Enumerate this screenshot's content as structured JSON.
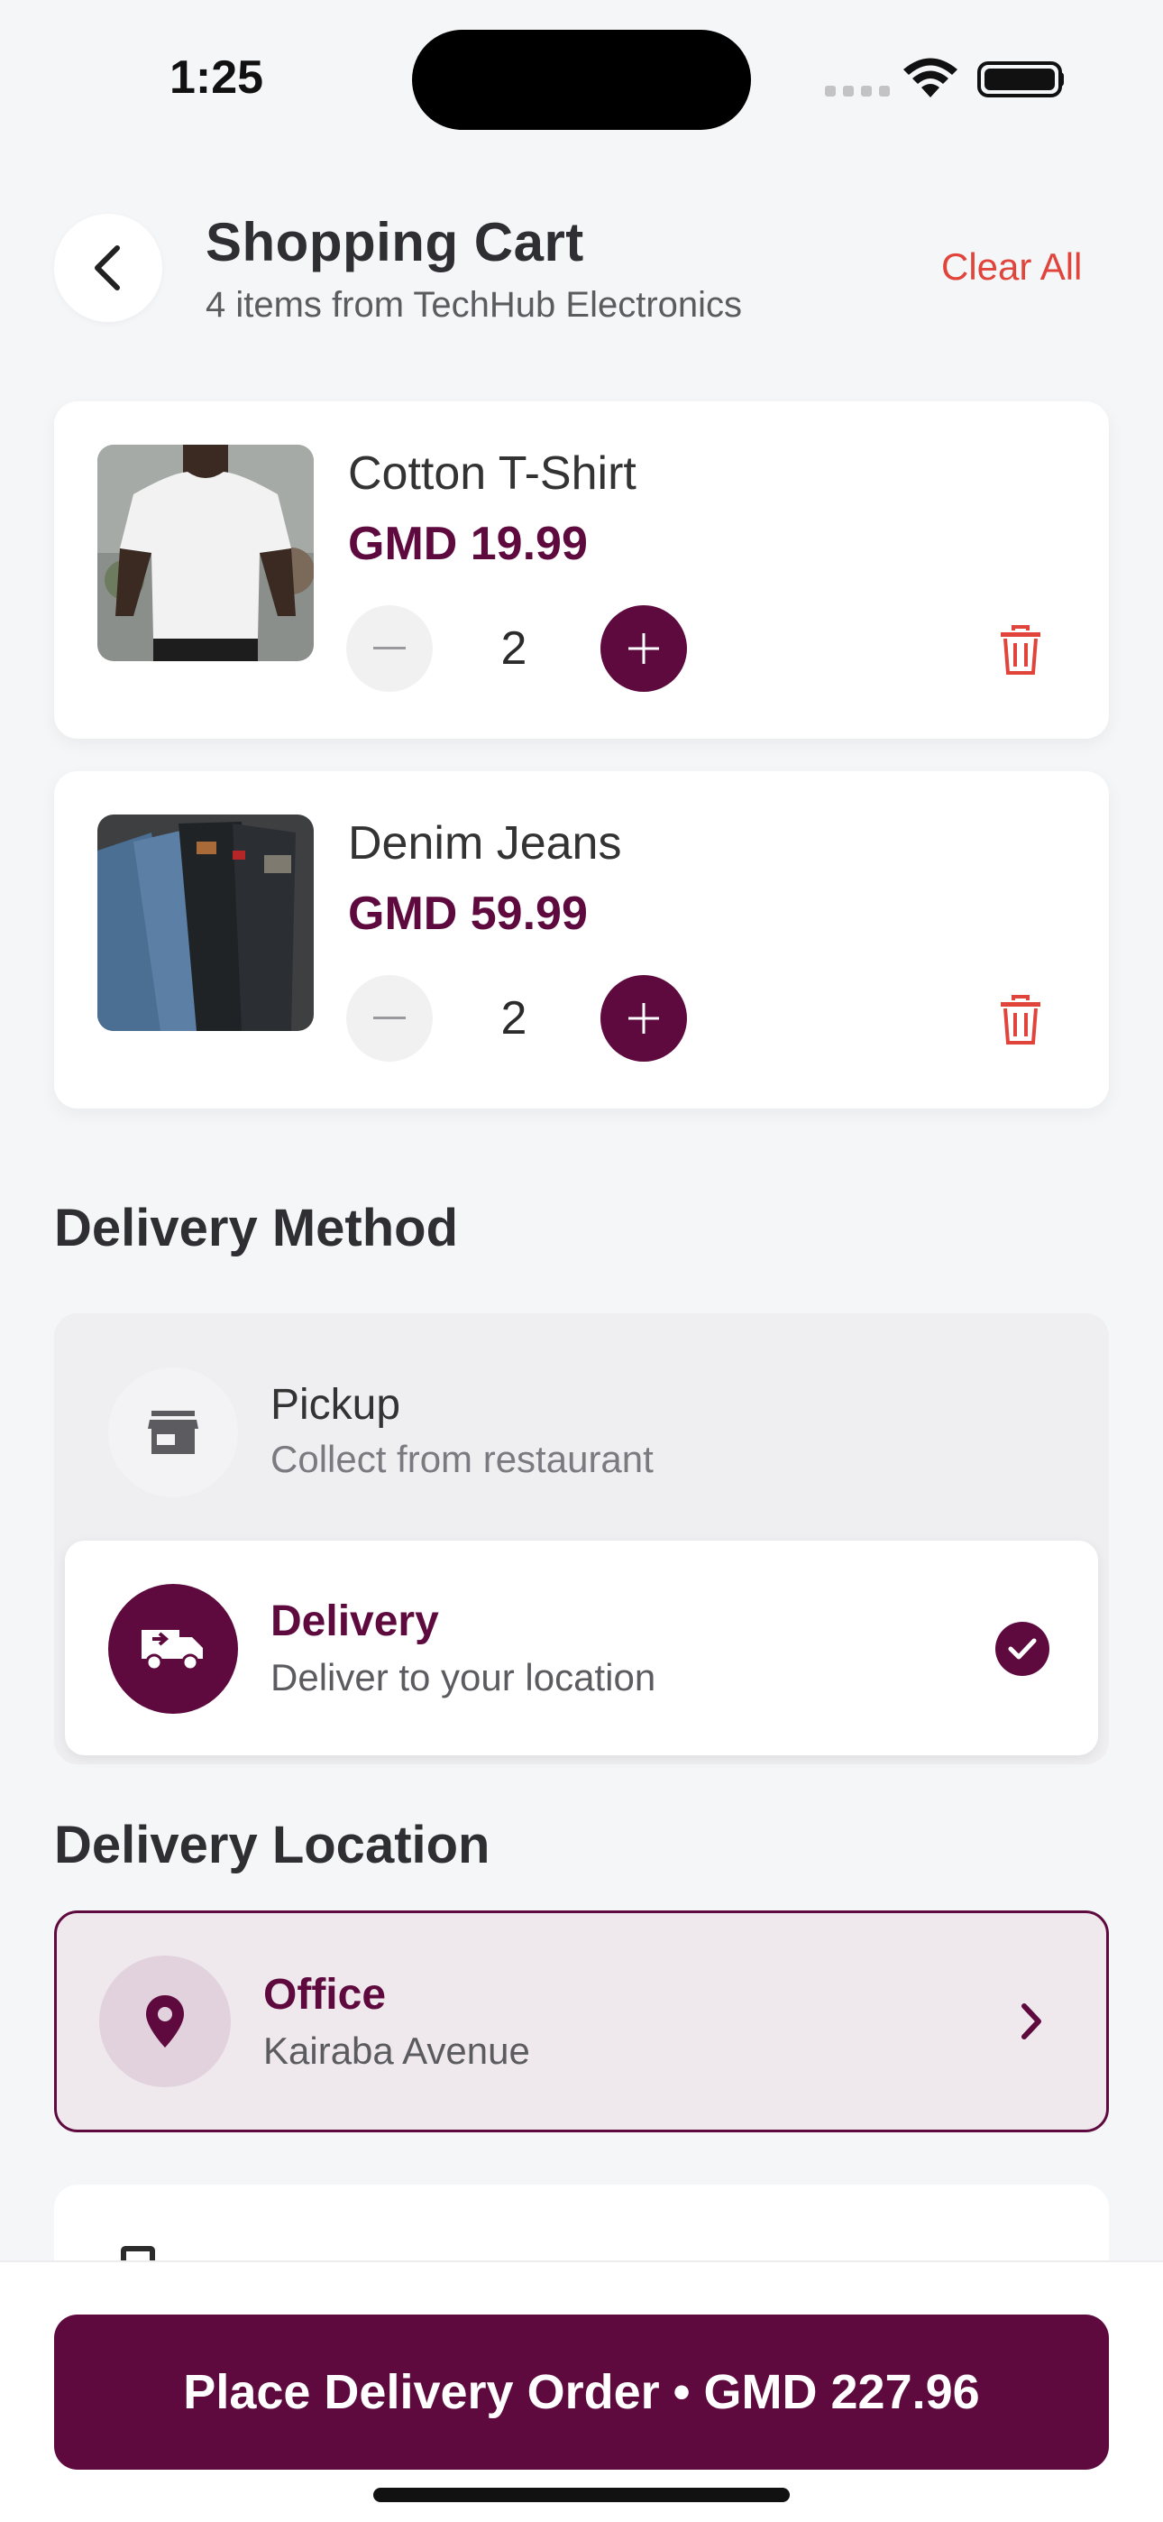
{
  "status_bar": {
    "time": "1:25"
  },
  "header": {
    "title": "Shopping Cart",
    "subtitle": "4 items from TechHub Electronics",
    "clear_all": "Clear All",
    "back_icon": "chevron-left-icon"
  },
  "cart": {
    "items": [
      {
        "name": "Cotton T-Shirt",
        "price": "GMD 19.99",
        "quantity": "2"
      },
      {
        "name": "Denim Jeans",
        "price": "GMD 59.99",
        "quantity": "2"
      }
    ]
  },
  "delivery_method": {
    "title": "Delivery Method",
    "options": [
      {
        "title": "Pickup",
        "subtitle": "Collect from restaurant",
        "icon": "store-icon",
        "selected": false
      },
      {
        "title": "Delivery",
        "subtitle": "Deliver to your location",
        "icon": "truck-icon",
        "selected": true
      }
    ]
  },
  "delivery_location": {
    "title": "Delivery Location",
    "label": "Office",
    "address": "Kairaba Avenue",
    "icon": "location-pin-icon"
  },
  "order_button": {
    "label": "Place Delivery Order • GMD 227.96"
  },
  "colors": {
    "brand": "#5e0a3e",
    "danger": "#e0443a",
    "background": "#f5f6f8"
  }
}
